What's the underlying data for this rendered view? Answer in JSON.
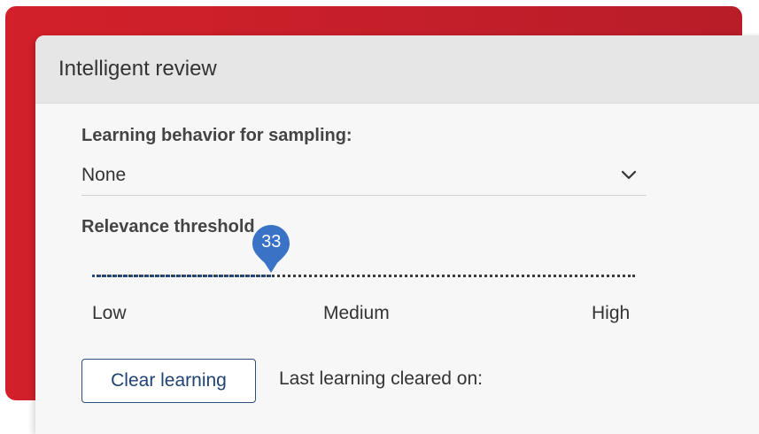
{
  "dialog": {
    "title": "Intelligent review"
  },
  "learning": {
    "label": "Learning behavior for sampling:",
    "selected_value": "None"
  },
  "threshold": {
    "label": "Relevance threshold",
    "value": 33,
    "value_text": "33",
    "min": 0,
    "max": 100,
    "scale_labels": {
      "low": "Low",
      "medium": "Medium",
      "high": "High"
    },
    "fill_color": "#1f4e8f",
    "thumb_color": "#3a73c6"
  },
  "actions": {
    "clear_label": "Clear learning",
    "last_cleared_label": "Last learning cleared on:"
  },
  "colors": {
    "backdrop_red": "#d3202a",
    "button_border": "#2e4f7a"
  },
  "icons": {
    "dropdown": "chevron-down-icon",
    "thumb": "slider-thumb-pin"
  }
}
